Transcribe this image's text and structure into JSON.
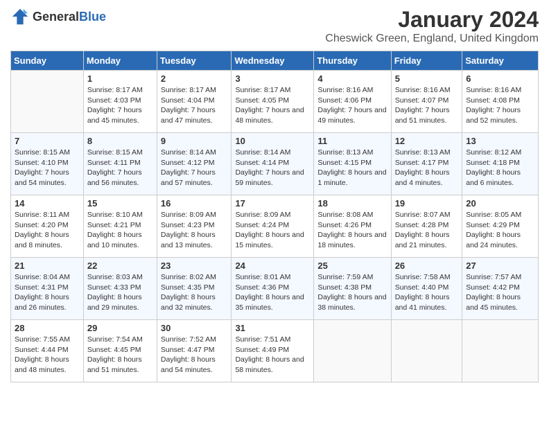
{
  "header": {
    "logo": {
      "text_general": "General",
      "text_blue": "Blue"
    },
    "title": "January 2024",
    "location": "Cheswick Green, England, United Kingdom"
  },
  "days_of_week": [
    "Sunday",
    "Monday",
    "Tuesday",
    "Wednesday",
    "Thursday",
    "Friday",
    "Saturday"
  ],
  "weeks": [
    [
      {
        "date": "",
        "sunrise": "",
        "sunset": "",
        "daylight": ""
      },
      {
        "date": "1",
        "sunrise": "Sunrise: 8:17 AM",
        "sunset": "Sunset: 4:03 PM",
        "daylight": "Daylight: 7 hours and 45 minutes."
      },
      {
        "date": "2",
        "sunrise": "Sunrise: 8:17 AM",
        "sunset": "Sunset: 4:04 PM",
        "daylight": "Daylight: 7 hours and 47 minutes."
      },
      {
        "date": "3",
        "sunrise": "Sunrise: 8:17 AM",
        "sunset": "Sunset: 4:05 PM",
        "daylight": "Daylight: 7 hours and 48 minutes."
      },
      {
        "date": "4",
        "sunrise": "Sunrise: 8:16 AM",
        "sunset": "Sunset: 4:06 PM",
        "daylight": "Daylight: 7 hours and 49 minutes."
      },
      {
        "date": "5",
        "sunrise": "Sunrise: 8:16 AM",
        "sunset": "Sunset: 4:07 PM",
        "daylight": "Daylight: 7 hours and 51 minutes."
      },
      {
        "date": "6",
        "sunrise": "Sunrise: 8:16 AM",
        "sunset": "Sunset: 4:08 PM",
        "daylight": "Daylight: 7 hours and 52 minutes."
      }
    ],
    [
      {
        "date": "7",
        "sunrise": "Sunrise: 8:15 AM",
        "sunset": "Sunset: 4:10 PM",
        "daylight": "Daylight: 7 hours and 54 minutes."
      },
      {
        "date": "8",
        "sunrise": "Sunrise: 8:15 AM",
        "sunset": "Sunset: 4:11 PM",
        "daylight": "Daylight: 7 hours and 56 minutes."
      },
      {
        "date": "9",
        "sunrise": "Sunrise: 8:14 AM",
        "sunset": "Sunset: 4:12 PM",
        "daylight": "Daylight: 7 hours and 57 minutes."
      },
      {
        "date": "10",
        "sunrise": "Sunrise: 8:14 AM",
        "sunset": "Sunset: 4:14 PM",
        "daylight": "Daylight: 7 hours and 59 minutes."
      },
      {
        "date": "11",
        "sunrise": "Sunrise: 8:13 AM",
        "sunset": "Sunset: 4:15 PM",
        "daylight": "Daylight: 8 hours and 1 minute."
      },
      {
        "date": "12",
        "sunrise": "Sunrise: 8:13 AM",
        "sunset": "Sunset: 4:17 PM",
        "daylight": "Daylight: 8 hours and 4 minutes."
      },
      {
        "date": "13",
        "sunrise": "Sunrise: 8:12 AM",
        "sunset": "Sunset: 4:18 PM",
        "daylight": "Daylight: 8 hours and 6 minutes."
      }
    ],
    [
      {
        "date": "14",
        "sunrise": "Sunrise: 8:11 AM",
        "sunset": "Sunset: 4:20 PM",
        "daylight": "Daylight: 8 hours and 8 minutes."
      },
      {
        "date": "15",
        "sunrise": "Sunrise: 8:10 AM",
        "sunset": "Sunset: 4:21 PM",
        "daylight": "Daylight: 8 hours and 10 minutes."
      },
      {
        "date": "16",
        "sunrise": "Sunrise: 8:09 AM",
        "sunset": "Sunset: 4:23 PM",
        "daylight": "Daylight: 8 hours and 13 minutes."
      },
      {
        "date": "17",
        "sunrise": "Sunrise: 8:09 AM",
        "sunset": "Sunset: 4:24 PM",
        "daylight": "Daylight: 8 hours and 15 minutes."
      },
      {
        "date": "18",
        "sunrise": "Sunrise: 8:08 AM",
        "sunset": "Sunset: 4:26 PM",
        "daylight": "Daylight: 8 hours and 18 minutes."
      },
      {
        "date": "19",
        "sunrise": "Sunrise: 8:07 AM",
        "sunset": "Sunset: 4:28 PM",
        "daylight": "Daylight: 8 hours and 21 minutes."
      },
      {
        "date": "20",
        "sunrise": "Sunrise: 8:05 AM",
        "sunset": "Sunset: 4:29 PM",
        "daylight": "Daylight: 8 hours and 24 minutes."
      }
    ],
    [
      {
        "date": "21",
        "sunrise": "Sunrise: 8:04 AM",
        "sunset": "Sunset: 4:31 PM",
        "daylight": "Daylight: 8 hours and 26 minutes."
      },
      {
        "date": "22",
        "sunrise": "Sunrise: 8:03 AM",
        "sunset": "Sunset: 4:33 PM",
        "daylight": "Daylight: 8 hours and 29 minutes."
      },
      {
        "date": "23",
        "sunrise": "Sunrise: 8:02 AM",
        "sunset": "Sunset: 4:35 PM",
        "daylight": "Daylight: 8 hours and 32 minutes."
      },
      {
        "date": "24",
        "sunrise": "Sunrise: 8:01 AM",
        "sunset": "Sunset: 4:36 PM",
        "daylight": "Daylight: 8 hours and 35 minutes."
      },
      {
        "date": "25",
        "sunrise": "Sunrise: 7:59 AM",
        "sunset": "Sunset: 4:38 PM",
        "daylight": "Daylight: 8 hours and 38 minutes."
      },
      {
        "date": "26",
        "sunrise": "Sunrise: 7:58 AM",
        "sunset": "Sunset: 4:40 PM",
        "daylight": "Daylight: 8 hours and 41 minutes."
      },
      {
        "date": "27",
        "sunrise": "Sunrise: 7:57 AM",
        "sunset": "Sunset: 4:42 PM",
        "daylight": "Daylight: 8 hours and 45 minutes."
      }
    ],
    [
      {
        "date": "28",
        "sunrise": "Sunrise: 7:55 AM",
        "sunset": "Sunset: 4:44 PM",
        "daylight": "Daylight: 8 hours and 48 minutes."
      },
      {
        "date": "29",
        "sunrise": "Sunrise: 7:54 AM",
        "sunset": "Sunset: 4:45 PM",
        "daylight": "Daylight: 8 hours and 51 minutes."
      },
      {
        "date": "30",
        "sunrise": "Sunrise: 7:52 AM",
        "sunset": "Sunset: 4:47 PM",
        "daylight": "Daylight: 8 hours and 54 minutes."
      },
      {
        "date": "31",
        "sunrise": "Sunrise: 7:51 AM",
        "sunset": "Sunset: 4:49 PM",
        "daylight": "Daylight: 8 hours and 58 minutes."
      },
      {
        "date": "",
        "sunrise": "",
        "sunset": "",
        "daylight": ""
      },
      {
        "date": "",
        "sunrise": "",
        "sunset": "",
        "daylight": ""
      },
      {
        "date": "",
        "sunrise": "",
        "sunset": "",
        "daylight": ""
      }
    ]
  ]
}
